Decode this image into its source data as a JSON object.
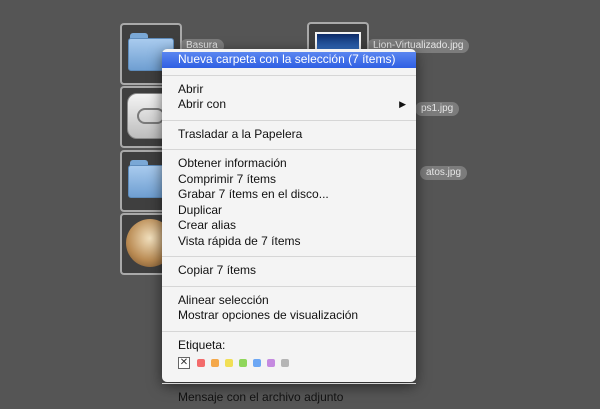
{
  "desktop": {
    "labels": {
      "basura": "Basura",
      "lion_virtualizado": "Lion-Virtualizado.jpg",
      "ps1": "ps1.jpg",
      "atos": "atos.jpg"
    },
    "icons": [
      "folder-icon",
      "icloud-icon",
      "folder-icon",
      "mountain-lion-icon"
    ]
  },
  "context_menu": {
    "new_folder": "Nueva carpeta con la selección (7 ítems)",
    "open": "Abrir",
    "open_with": "Abrir con",
    "move_to_trash": "Trasladar a la Papelera",
    "get_info": "Obtener información",
    "compress": "Comprimir 7 ítems",
    "burn": "Grabar 7 ítems en el disco...",
    "duplicate": "Duplicar",
    "make_alias": "Crear alias",
    "quick_look": "Vista rápida de 7 ítems",
    "copy": "Copiar 7 ítems",
    "align_selection": "Alinear selección",
    "show_view_options": "Mostrar opciones de visualización",
    "label_title": "Etiqueta:",
    "attach_mail": "Mensaje con el archivo adjunto",
    "submenu_arrow": "▶",
    "no_label_glyph": "✕"
  },
  "colors": {
    "highlight": "#2f5fe3",
    "label_red": "#f36b6b",
    "label_orange": "#f4a84a",
    "label_yellow": "#f1df55",
    "label_green": "#8fd65a",
    "label_blue": "#6ca7f4",
    "label_purple": "#c58ae0",
    "label_gray": "#b5b5b5"
  }
}
